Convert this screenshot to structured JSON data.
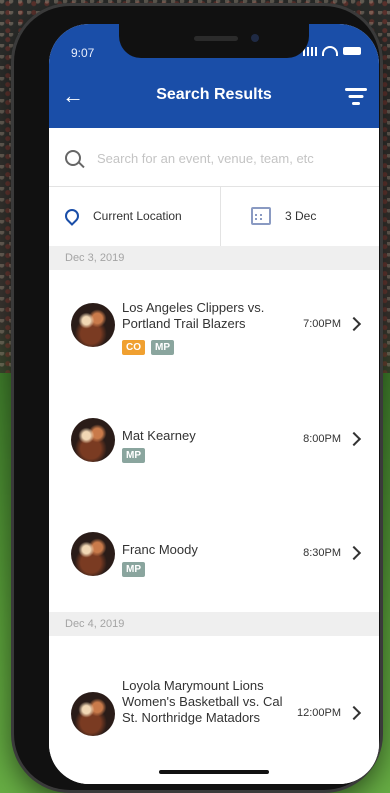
{
  "status_bar": {
    "time": "9:07"
  },
  "header": {
    "title": "Search Results"
  },
  "search": {
    "placeholder": "Search for an event, venue, team, etc"
  },
  "filters": {
    "location_label": "Current Location",
    "date_label": "3 Dec"
  },
  "sections": [
    {
      "date": "Dec 3, 2019",
      "events": [
        {
          "name": "Los Angeles Clippers vs. Portland Trail Blazers",
          "time": "7:00PM",
          "badges": [
            "CO",
            "MP"
          ]
        },
        {
          "name": "Mat Kearney",
          "time": "8:00PM",
          "badges": [
            "MP"
          ]
        },
        {
          "name": "Franc Moody",
          "time": "8:30PM",
          "badges": [
            "MP"
          ]
        }
      ]
    },
    {
      "date": "Dec 4, 2019",
      "events": [
        {
          "name": "Loyola Marymount Lions Women's Basketball vs. Cal St. Northridge Matadors",
          "time": "12:00PM",
          "badges": []
        }
      ]
    }
  ],
  "colors": {
    "brand_blue": "#1a4ea8",
    "badge_co": "#f0a030",
    "badge_mp": "#8aa59e"
  },
  "icons": {
    "back": "arrow-left-icon",
    "filter": "filter-icon",
    "search": "search-icon",
    "location": "location-pin-icon",
    "calendar": "calendar-icon",
    "chevron": "chevron-right-icon"
  }
}
